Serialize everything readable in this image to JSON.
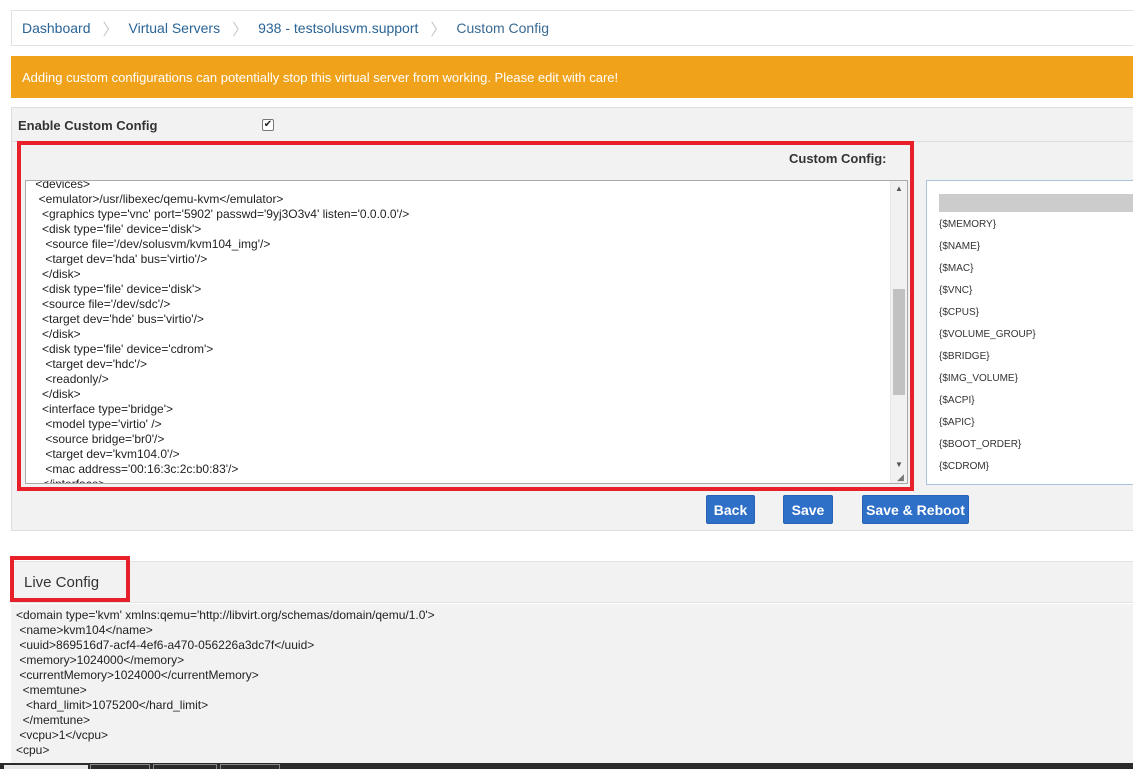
{
  "breadcrumb": {
    "items": [
      "Dashboard",
      "Virtual Servers",
      "938 - testsolusvm.support",
      "Custom Config"
    ],
    "separator": "〉"
  },
  "warning": {
    "text": "Adding custom configurations can potentially stop this virtual server from working. Please edit with care!",
    "color": "#f0a21a"
  },
  "enable": {
    "label": "Enable Custom Config",
    "checked": true,
    "check_glyph": "✔"
  },
  "editor": {
    "label": "Custom Config:",
    "lines": [
      " <devices>",
      "  <emulator>/usr/libexec/qemu-kvm</emulator>",
      "   <graphics type='vnc' port='5902' passwd='9yj3O3v4' listen='0.0.0.0'/>",
      "   <disk type='file' device='disk'>",
      "    <source file='/dev/solusvm/kvm104_img'/>",
      "    <target dev='hda' bus='virtio'/>",
      "   </disk>",
      "   <disk type='file' device='disk'>",
      "   <source file='/dev/sdc'/>",
      "   <target dev='hde' bus='virtio'/>",
      "   </disk>",
      "   <disk type='file' device='cdrom'>",
      "    <target dev='hdc'/>",
      "    <readonly/>",
      "   </disk>",
      "   <interface type='bridge'>",
      "    <model type='virtio' />",
      "    <source bridge='br0'/>",
      "    <target dev='kvm104.0'/>",
      "    <mac address='00:16:3c:2c:b0:83'/>",
      "   </interface>"
    ]
  },
  "variables": [
    "{$MEMORY}",
    "{$NAME}",
    "{$MAC}",
    "{$VNC}",
    "{$CPUS}",
    "{$VOLUME_GROUP}",
    "{$BRIDGE}",
    "{$IMG_VOLUME}",
    "{$ACPI}",
    "{$APIC}",
    "{$BOOT_ORDER}",
    "{$CDROM}"
  ],
  "buttons": {
    "back": "Back",
    "save": "Save",
    "save_reboot": "Save & Reboot"
  },
  "live": {
    "title": "Live Config",
    "lines": [
      "<domain type='kvm' xmlns:qemu='http://libvirt.org/schemas/domain/qemu/1.0'>",
      " <name>kvm104</name>",
      " <uuid>869516d7-acf4-4ef6-a470-056226a3dc7f</uuid>",
      " <memory>1024000</memory>",
      " <currentMemory>1024000</currentMemory>",
      "  <memtune>",
      "   <hard_limit>1075200</hard_limit>",
      "  </memtune>",
      " <vcpu>1</vcpu>",
      "<cpu>"
    ]
  },
  "colors": {
    "highlight": "#e8202a",
    "button": "#2e6fc7",
    "link": "#2a6496"
  }
}
